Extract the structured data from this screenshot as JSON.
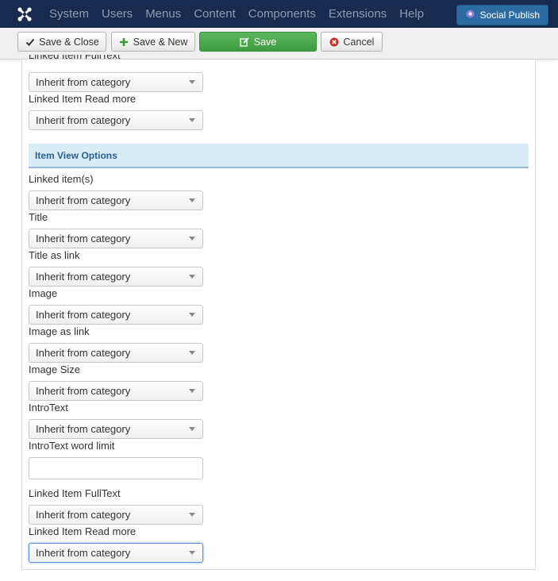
{
  "navbar": {
    "menu": [
      "System",
      "Users",
      "Menus",
      "Content",
      "Components",
      "Extensions",
      "Help"
    ],
    "social_publish_label": "Social Publish"
  },
  "toolbar": {
    "save_close_label": "Save & Close",
    "save_new_label": "Save & New",
    "save_label": "Save",
    "cancel_label": "Cancel"
  },
  "top_fields": [
    {
      "label": "Linked Item FullText",
      "value": "Inherit from category"
    },
    {
      "label": "Linked Item Read more",
      "value": "Inherit from category"
    }
  ],
  "section": {
    "title": "Item View Options"
  },
  "fields": [
    {
      "label": "Linked item(s)",
      "value": "Inherit from category"
    },
    {
      "label": "Title",
      "value": "Inherit from category"
    },
    {
      "label": "Title as link",
      "value": "Inherit from category"
    },
    {
      "label": "Image",
      "value": "Inherit from category"
    },
    {
      "label": "Image as link",
      "value": "Inherit from category"
    },
    {
      "label": "Image Size",
      "value": "Inherit from category"
    },
    {
      "label": "IntroText",
      "value": "Inherit from category"
    },
    {
      "label": "IntroText word limit",
      "value": ""
    },
    {
      "label": "Linked Item FullText",
      "value": "Inherit from category"
    },
    {
      "label": "Linked Item Read more",
      "value": "Inherit from category"
    }
  ],
  "colors": {
    "navbar_bg": "#162b4e",
    "save_green": "#4cae4c",
    "section_bg": "#d9edf7",
    "section_text": "#2a5f93"
  }
}
